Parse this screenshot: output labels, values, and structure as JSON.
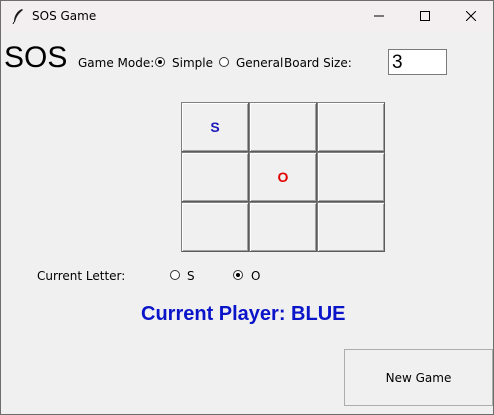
{
  "window": {
    "title": "SOS Game"
  },
  "header": {
    "logo": "SOS",
    "game_mode_label": "Game Mode:",
    "modes": [
      {
        "label": "Simple",
        "checked": true
      },
      {
        "label": "General",
        "checked": false
      }
    ],
    "board_size_label": "Board Size:",
    "board_size_value": "3"
  },
  "board": {
    "rows": 3,
    "cols": 3,
    "cells": [
      [
        {
          "letter": "S",
          "color": "#1a1ab8"
        },
        {
          "letter": "",
          "color": ""
        },
        {
          "letter": "",
          "color": ""
        }
      ],
      [
        {
          "letter": "",
          "color": ""
        },
        {
          "letter": "O",
          "color": "#e00000"
        },
        {
          "letter": "",
          "color": ""
        }
      ],
      [
        {
          "letter": "",
          "color": ""
        },
        {
          "letter": "",
          "color": ""
        },
        {
          "letter": "",
          "color": ""
        }
      ]
    ]
  },
  "letter_select": {
    "label": "Current Letter:",
    "options": [
      {
        "label": "S",
        "checked": false
      },
      {
        "label": "O",
        "checked": true
      }
    ]
  },
  "status": {
    "current_player": "Current Player: BLUE",
    "color": "#0a14c9"
  },
  "actions": {
    "new_game_label": "New Game"
  }
}
